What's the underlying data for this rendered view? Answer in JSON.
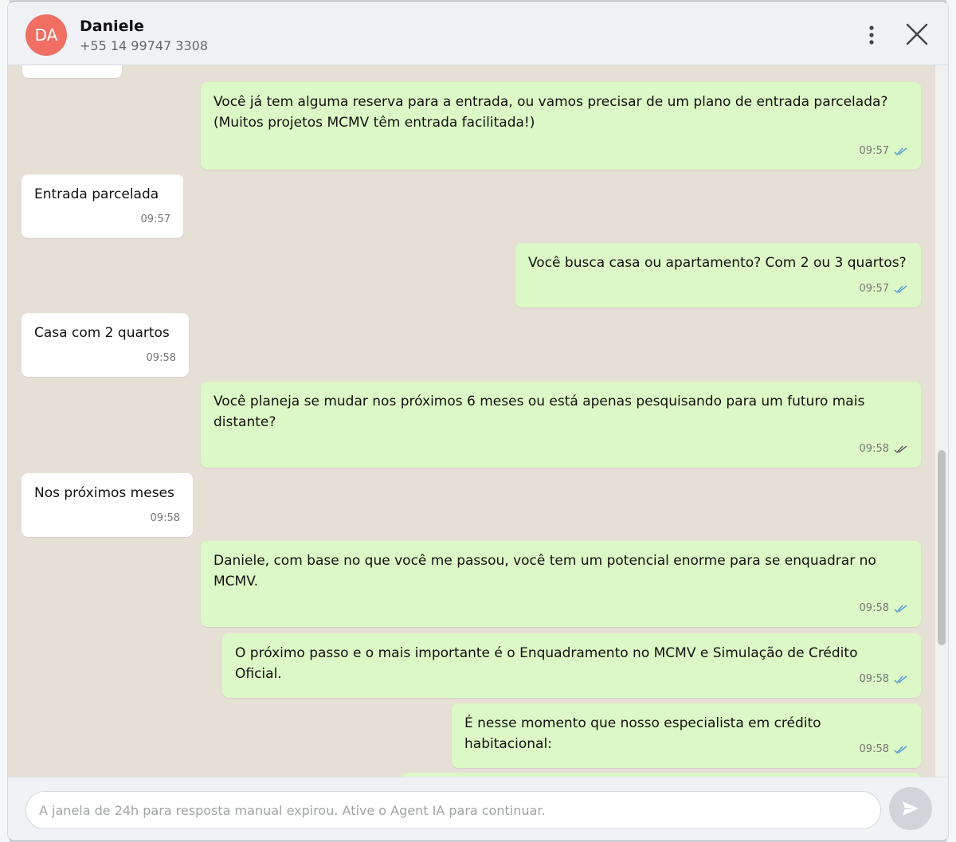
{
  "contact": {
    "initials": "DA",
    "name": "Daniele",
    "phone": "+55 14 99747 3308"
  },
  "messages": [
    {
      "direction": "outgoing",
      "text": "Você já tem alguma reserva para a entrada, ou vamos precisar de um plano de entrada parcelada? (Muitos projetos MCMV têm entrada facilitada!)",
      "time": "09:57",
      "status": "read"
    },
    {
      "direction": "incoming",
      "text": "Entrada parcelada",
      "time": "09:57"
    },
    {
      "direction": "outgoing",
      "text": "Você busca casa ou apartamento? Com 2 ou 3 quartos?",
      "time": "09:57",
      "status": "read"
    },
    {
      "direction": "incoming",
      "text": "Casa com 2 quartos",
      "time": "09:58"
    },
    {
      "direction": "outgoing",
      "text": "Você planeja se mudar nos próximos 6 meses ou está apenas pesquisando para um futuro mais distante?",
      "time": "09:58",
      "status": "delivered"
    },
    {
      "direction": "incoming",
      "text": "Nos próximos meses",
      "time": "09:58"
    },
    {
      "direction": "outgoing",
      "text": "Daniele, com base no que você me passou, você tem um potencial enorme para se enquadrar no MCMV.",
      "time": "09:58",
      "status": "read"
    },
    {
      "direction": "outgoing",
      "text": "O próximo passo e o mais importante é o Enquadramento no MCMV e Simulação de Crédito Oficial.",
      "time": "09:58",
      "status": "read"
    },
    {
      "direction": "outgoing",
      "text": "É nesse momento que nosso especialista em crédito habitacional:",
      "time": "09:58",
      "status": "read"
    }
  ],
  "composer": {
    "placeholder": "A janela de 24h para resposta manual expirou. Ative o Agent IA para continuar."
  },
  "colors": {
    "avatar": "#ef6f63",
    "outgoing_bubble": "#dcf8c6",
    "incoming_bubble": "#ffffff",
    "chat_background": "#e6dfd6",
    "read_check": "#5b9fd8",
    "delivered_check": "#777777"
  },
  "icons": {
    "menu": "more-vertical-icon",
    "close": "close-icon",
    "send": "send-icon",
    "read": "double-check-icon"
  }
}
